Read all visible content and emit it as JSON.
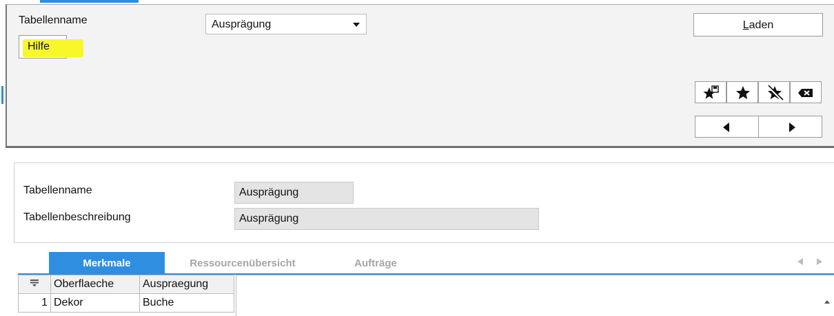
{
  "filter": {
    "tabellenname_label": "Tabellenname",
    "selected_table": "Ausprägung",
    "help_label": "Hilfe",
    "load_label_first": "L",
    "load_label_rest": "aden"
  },
  "icons": {
    "bookmark_save": "bookmark-save-icon",
    "star": "star-icon",
    "star_remove": "star-remove-icon",
    "backspace": "backspace-icon",
    "prev": "triangle-left-icon",
    "next": "triangle-right-icon"
  },
  "detail": {
    "tabellenname_label": "Tabellenname",
    "tabellenname_value": "Ausprägung",
    "beschreibung_label": "Tabellenbeschreibung",
    "beschreibung_value": "Ausprägung"
  },
  "tabs": [
    {
      "label": "Merkmale"
    },
    {
      "label": "Ressourcenübersicht"
    },
    {
      "label": "Aufträge"
    }
  ],
  "table": {
    "columns": [
      "Oberflaeche",
      "Auspraegung"
    ],
    "rows": [
      {
        "num": "1",
        "cells": [
          "Dekor",
          "Buche"
        ]
      }
    ]
  },
  "colors": {
    "accent": "#2f8ee0",
    "highlight": "#f7f72a"
  }
}
